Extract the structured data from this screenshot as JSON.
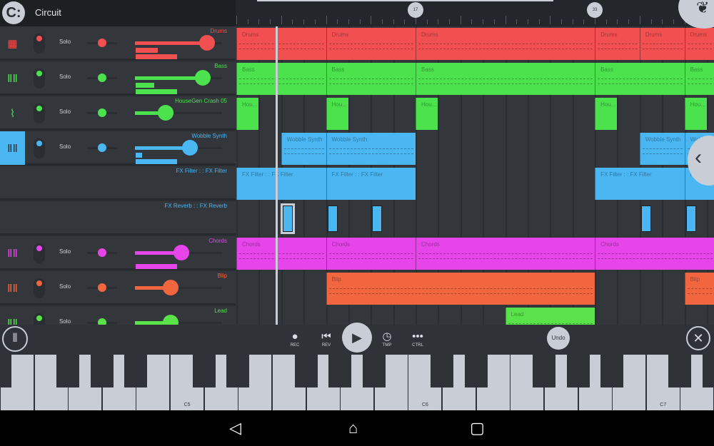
{
  "header": {
    "project_title": "Circuit",
    "logo_icon": "fl-circuit-logo"
  },
  "ruler": {
    "markers": [
      17,
      33
    ]
  },
  "tracks": [
    {
      "name": "Drums",
      "type": "drums",
      "color": "#f25050",
      "solo": "Solo",
      "volume": 0.83,
      "pan": 0
    },
    {
      "name": "Bass",
      "type": "keys",
      "color": "#4ce24e",
      "solo": "Solo",
      "volume": 0.78,
      "pan": 0
    },
    {
      "name": "HouseGen Crash 05",
      "type": "audio",
      "color": "#4ce24e",
      "solo": "Solo",
      "volume": 0.35,
      "pan": 0
    },
    {
      "name": "Wobble Synth",
      "type": "keys",
      "color": "#4ab6f2",
      "solo": "Solo",
      "volume": 0.63,
      "pan": 0,
      "selected": true
    },
    {
      "name": "FX Filter : : FX Filter",
      "type": "fx",
      "color": "#4ab6f2"
    },
    {
      "name": "FX Reverb : : FX Reverb",
      "type": "fx",
      "color": "#4ab6f2"
    },
    {
      "name": "Chords",
      "type": "keys",
      "color": "#e645ea",
      "solo": "Solo",
      "volume": 0.53,
      "pan": 0
    },
    {
      "name": "Blip",
      "type": "keys",
      "color": "#f2663f",
      "solo": "Solo",
      "volume": 0.41,
      "pan": 0
    },
    {
      "name": "Lead",
      "type": "keys",
      "color": "#5ae24a",
      "solo": "Solo",
      "volume": 0.41,
      "pan": 0
    }
  ],
  "clips": [
    [
      {
        "label": "Drums",
        "start": 1,
        "end": 9
      },
      {
        "label": "Drums",
        "start": 9,
        "end": 17
      },
      {
        "label": "Drums",
        "start": 17,
        "end": 33
      },
      {
        "label": "Drums",
        "start": 33,
        "end": 37
      },
      {
        "label": "Drums",
        "start": 37,
        "end": 41
      },
      {
        "label": "Drums",
        "start": 41,
        "end": 45
      }
    ],
    [
      {
        "label": "Bass",
        "start": 1,
        "end": 9
      },
      {
        "label": "Bass",
        "start": 9,
        "end": 17
      },
      {
        "label": "Bass",
        "start": 17,
        "end": 33
      },
      {
        "label": "Bass",
        "start": 33,
        "end": 41
      },
      {
        "label": "Bass",
        "start": 41,
        "end": 45
      }
    ],
    [
      {
        "label": "Hou...",
        "start": 1,
        "end": 3
      },
      {
        "label": "Hou...",
        "start": 9,
        "end": 11
      },
      {
        "label": "Hou...",
        "start": 17,
        "end": 19
      },
      {
        "label": "Hou...",
        "start": 33,
        "end": 35
      },
      {
        "label": "Hou...",
        "start": 41,
        "end": 43
      }
    ],
    [
      {
        "label": "Wobble Synth",
        "start": 5,
        "end": 9
      },
      {
        "label": "Wobble Synth",
        "start": 9,
        "end": 17
      },
      {
        "label": "Wobble Synth",
        "start": 37,
        "end": 41
      },
      {
        "label": "Wobble Synth",
        "start": 41,
        "end": 45
      }
    ],
    [
      {
        "label": "FX Filter : : FX Filter",
        "start": 1,
        "end": 9
      },
      {
        "label": "FX Filter : : FX Filter",
        "start": 9,
        "end": 17
      },
      {
        "label": "FX Filter : : FX Filter",
        "start": 33,
        "end": 41
      },
      {
        "label": "FX Filter : : FX Filter",
        "start": 41,
        "end": 45
      }
    ],
    [
      {
        "label": "",
        "start": 5,
        "end": 6,
        "selected": true
      },
      {
        "label": "",
        "start": 9,
        "end": 10
      },
      {
        "label": "",
        "start": 13,
        "end": 14
      },
      {
        "label": "",
        "start": 37,
        "end": 38
      },
      {
        "label": "",
        "start": 41,
        "end": 42
      }
    ],
    [
      {
        "label": "Chords",
        "start": 1,
        "end": 9
      },
      {
        "label": "Chords",
        "start": 9,
        "end": 17
      },
      {
        "label": "Chords",
        "start": 17,
        "end": 33
      },
      {
        "label": "Chords",
        "start": 33,
        "end": 45
      }
    ],
    [
      {
        "label": "Blip",
        "start": 9,
        "end": 33
      },
      {
        "label": "Blip",
        "start": 41,
        "end": 45
      }
    ],
    [
      {
        "label": "Lead",
        "start": 25,
        "end": 33
      }
    ]
  ],
  "playhead_bar": 4.6,
  "transport": {
    "rec": "REC",
    "rev": "REV",
    "tmp": "TMP",
    "ctrl": "CTRL",
    "undo": "Undo"
  },
  "piano": {
    "labels": [
      "C5",
      "C6",
      "C7"
    ]
  }
}
